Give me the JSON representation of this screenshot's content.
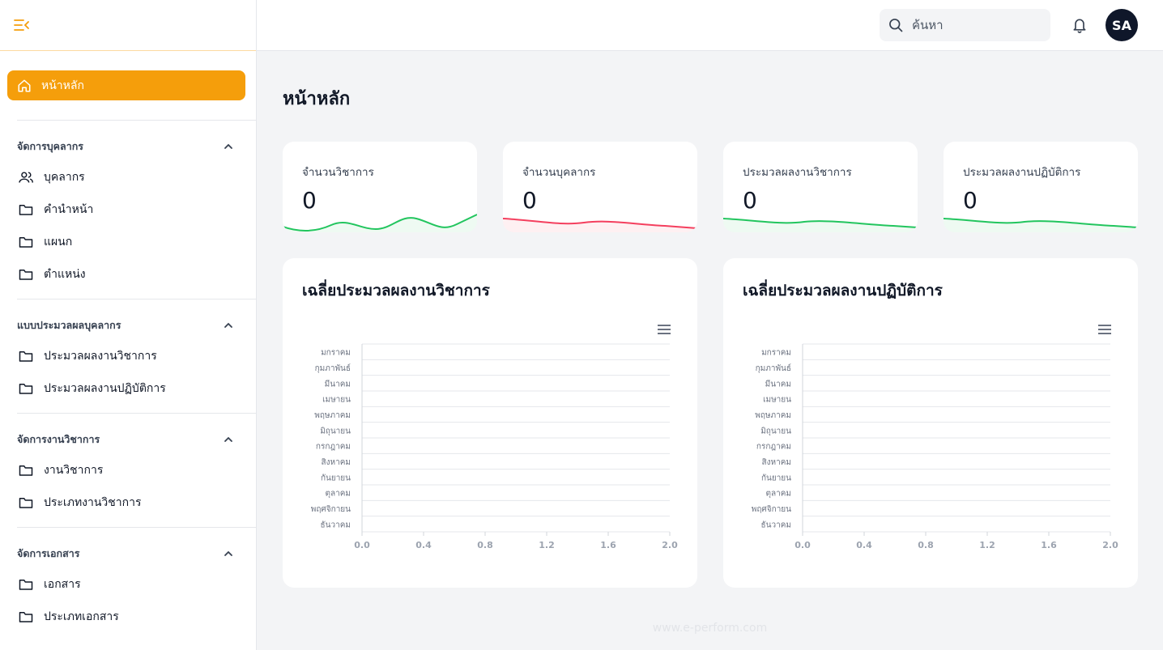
{
  "sidebar": {
    "home_label": "หน้าหลัก",
    "sections": [
      {
        "title": "จัดการบุคลากร",
        "items": [
          "บุคลากร",
          "คำนำหน้า",
          "แผนก",
          "ตำแหน่ง"
        ]
      },
      {
        "title": "แบบประมวลผลบุคลากร",
        "items": [
          "ประมวลผลงานวิชาการ",
          "ประมวลผลงานปฏิบัติการ"
        ]
      },
      {
        "title": "จัดการงานวิชาการ",
        "items": [
          "งานวิชาการ",
          "ประเภทงานวิชาการ"
        ]
      },
      {
        "title": "จัดการเอกสาร",
        "items": [
          "เอกสาร",
          "ประเภทเอกสาร"
        ]
      }
    ]
  },
  "topbar": {
    "search_placeholder": "ค้นหา",
    "avatar_initials": "SA"
  },
  "main": {
    "title": "หน้าหลัก",
    "stats": [
      {
        "label": "จำนวนวิชาการ",
        "value": "0",
        "color": "#22c55e"
      },
      {
        "label": "จำนวนบุคลากร",
        "value": "0",
        "color": "#f43f5e"
      },
      {
        "label": "ประมวลผลงานวิชาการ",
        "value": "0",
        "color": "#22c55e"
      },
      {
        "label": "ประมวลผลงานปฏิบัติการ",
        "value": "0",
        "color": "#22c55e"
      }
    ]
  },
  "chart_data": [
    {
      "type": "bar",
      "orientation": "horizontal",
      "title": "เฉลี่ยประมวลผลงานวิชาการ",
      "categories": [
        "มกราคม",
        "กุมภาพันธ์",
        "มีนาคม",
        "เมษายน",
        "พฤษภาคม",
        "มิถุนายน",
        "กรกฎาคม",
        "สิงหาคม",
        "กันยายน",
        "ตุลาคม",
        "พฤศจิกายน",
        "ธันวาคม"
      ],
      "values": [
        0,
        0,
        0,
        0,
        0,
        0,
        0,
        0,
        0,
        0,
        0,
        0
      ],
      "xlim": [
        0,
        2
      ],
      "xticks": [
        "0.0",
        "0.4",
        "0.8",
        "1.2",
        "1.6",
        "2.0"
      ],
      "grid": true
    },
    {
      "type": "bar",
      "orientation": "horizontal",
      "title": "เฉลี่ยประมวลผลงานปฏิบัติการ",
      "categories": [
        "มกราคม",
        "กุมภาพันธ์",
        "มีนาคม",
        "เมษายน",
        "พฤษภาคม",
        "มิถุนายน",
        "กรกฎาคม",
        "สิงหาคม",
        "กันยายน",
        "ตุลาคม",
        "พฤศจิกายน",
        "ธันวาคม"
      ],
      "values": [
        0,
        0,
        0,
        0,
        0,
        0,
        0,
        0,
        0,
        0,
        0,
        0
      ],
      "xlim": [
        0,
        2
      ],
      "xticks": [
        "0.0",
        "0.4",
        "0.8",
        "1.2",
        "1.6",
        "2.0"
      ],
      "grid": true
    }
  ],
  "footer": {
    "text": "www.e-perform.com"
  },
  "colors": {
    "accent": "#f59e0b",
    "avatar_bg": "#0f172a"
  }
}
